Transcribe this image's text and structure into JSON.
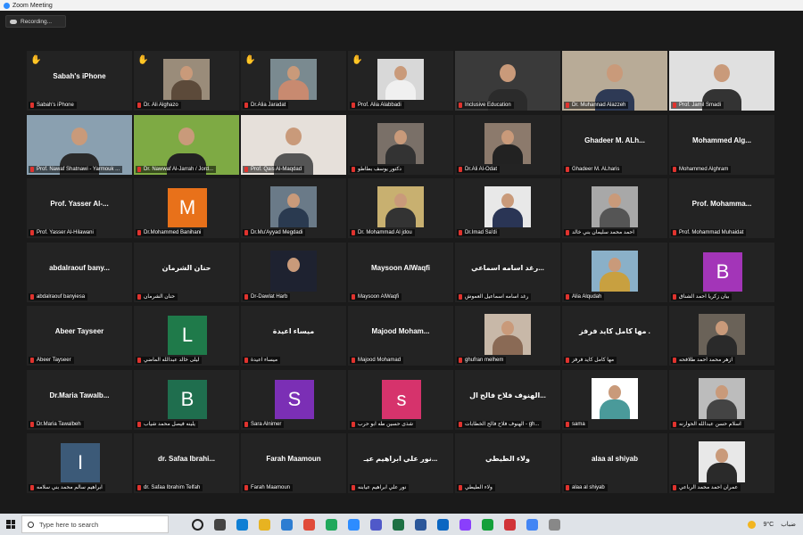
{
  "window": {
    "title": "Zoom Meeting"
  },
  "recording": {
    "label": "Recording..."
  },
  "accent": "#a6e22e",
  "tiles": [
    {
      "label": "Sabah's iPhone",
      "center": "Sabah's iPhone",
      "hand": true,
      "kind": "name"
    },
    {
      "label": "Dr. Ali Alghazo",
      "hand": true,
      "kind": "photo",
      "c1": "#9a8c7a",
      "c2": "#5c4a3a"
    },
    {
      "label": "Dr.Alia Jaradat",
      "hand": true,
      "kind": "photo",
      "c1": "#7a8a90",
      "c2": "#c88a70"
    },
    {
      "label": "Prof. Alia Alabbadi",
      "hand": true,
      "kind": "photo",
      "c1": "#d8d8d8",
      "c2": "#f0f0f0"
    },
    {
      "label": "Inclusive Education",
      "kind": "wide",
      "c1": "#3a3a3a",
      "c2": "#2b2b2b"
    },
    {
      "label": "Dr. Muhannad Alazzeh",
      "kind": "wide",
      "active": true,
      "c1": "#b8ab97",
      "c2": "#2e3a55"
    },
    {
      "label": "Prof. Jamil Smadi",
      "kind": "wide",
      "c1": "#e0e0e0",
      "c2": "#333"
    },
    {
      "label": "Prof. Nawaf Shatnawi - Yarmouk ...",
      "kind": "wide",
      "c1": "#8aa0b0",
      "c2": "#2a2a2a"
    },
    {
      "label": "Dr. Nawwaf Al-Jarrah / Jord...",
      "kind": "wide",
      "c1": "#7eaa44",
      "c2": "#222"
    },
    {
      "label": "Prof. Qais Al-Maqdad",
      "kind": "wide",
      "c1": "#e6e0da",
      "c2": "#555"
    },
    {
      "label": "دكتور يوسف بطاطو",
      "kind": "photo",
      "c1": "#7a7068",
      "c2": "#333"
    },
    {
      "label": "Dr.Ali Al-Odat",
      "kind": "photo",
      "c1": "#8c7a6c",
      "c2": "#222"
    },
    {
      "label": "Ghadeer M. ALharis",
      "center": "Ghadeer M. ALh...",
      "kind": "name"
    },
    {
      "label": "Mohammed Alghram",
      "center": "Mohammed Alg...",
      "kind": "name"
    },
    {
      "label": "Prof. Yasser Al-Hilawani",
      "center": "Prof. Yasser Al-...",
      "kind": "name"
    },
    {
      "label": "Dr.Mohammed Banihani",
      "kind": "avatar",
      "letter": "M",
      "color": "#e8711a"
    },
    {
      "label": "Dr.Mu'Ayyad Megdadi",
      "kind": "photo",
      "c1": "#6a7a88",
      "c2": "#2a3a50"
    },
    {
      "label": "Dr. Mohammad Al jdou",
      "kind": "photo",
      "c1": "#c8b070",
      "c2": "#333"
    },
    {
      "label": "Dr.Imad Sa'di",
      "kind": "photo",
      "c1": "#e8e8e8",
      "c2": "#2a3555"
    },
    {
      "label": "احمد محمد سليمان بني خالد",
      "kind": "photo",
      "c1": "#a8a8a8",
      "c2": "#555"
    },
    {
      "label": "Prof. Mohammad Muhaidat",
      "center": "Prof. Mohamma...",
      "kind": "name"
    },
    {
      "label": "abdalraouf banyiesa",
      "center": "abdalraouf bany...",
      "kind": "name"
    },
    {
      "label": "حنان الشرمان",
      "center": "حنان الشرمان",
      "kind": "name"
    },
    {
      "label": "Dr-Dawlat Harb",
      "kind": "photo",
      "c1": "#1e2230",
      "c2": "#1e2230"
    },
    {
      "label": "Maysoon AlWaqfi",
      "center": "Maysoon AlWaqfi",
      "kind": "name"
    },
    {
      "label": "رغد اسامه اسماعيل العموش",
      "center": "رغد اسامه اسماعي...",
      "kind": "name"
    },
    {
      "label": "Alia Alqudah",
      "kind": "photo",
      "c1": "#8ab0c8",
      "c2": "#c8a040"
    },
    {
      "label": "بيان زكريا احمد الشناق",
      "kind": "avatar",
      "letter": "B",
      "color": "#a335b8"
    },
    {
      "label": "Abeer Tayseer",
      "center": "Abeer Tayseer",
      "kind": "name"
    },
    {
      "label": "ليلى خالد عبدالله الماضي",
      "kind": "avatar",
      "letter": "L",
      "color": "#1f7a4a"
    },
    {
      "label": "ميساء اعيدة",
      "center": "ميساء اعيدة",
      "kind": "name"
    },
    {
      "label": "Majood Mohamad",
      "center": "Majood Moham...",
      "kind": "name"
    },
    {
      "label": "ghufran melhem",
      "kind": "photo",
      "c1": "#c8b8a8",
      "c2": "#8a6a55"
    },
    {
      "label": "مها كامل كايد فرفز",
      "center": "مها كامل كايد فرفز .",
      "kind": "name"
    },
    {
      "label": "ازهر محمد احمد طلافحه",
      "kind": "photo",
      "c1": "#6a6258",
      "c2": "#2a2a2a"
    },
    {
      "label": "Dr.Maria Tawalbeh",
      "center": "Dr.Maria Tawalb...",
      "kind": "name"
    },
    {
      "label": "يلينه فيصل محمد شياب",
      "kind": "avatar",
      "letter": "B",
      "color": "#1f6e4e"
    },
    {
      "label": "Sara Alnimer",
      "kind": "avatar",
      "letter": "S",
      "color": "#7b2fb5"
    },
    {
      "label": "شذى حسين طه ابو حرب",
      "kind": "avatar",
      "letter": "s",
      "color": "#d6336c"
    },
    {
      "label": "الهنوف فلاح فالح الخطابات - gh...",
      "center": "الهنوف فلاح فالح ال...",
      "kind": "name"
    },
    {
      "label": "sama",
      "kind": "photo",
      "c1": "#ffffff",
      "c2": "#4a9a9a"
    },
    {
      "label": "اسلام حسن عبدالله الحوارنه",
      "kind": "photo",
      "c1": "#bcbcbc",
      "c2": "#444"
    },
    {
      "label": "ابراهيم سالم محمد بني سلامه",
      "kind": "avatar",
      "letter": "I",
      "color": "#3c5a78"
    },
    {
      "label": "dr. Safaa Ibrahim Telfah",
      "center": "dr. Safaa Ibrahi...",
      "kind": "name"
    },
    {
      "label": "Farah Maamoun",
      "center": "Farah Maamoun",
      "kind": "name"
    },
    {
      "label": "نور علي ابراهيم عيابنه",
      "center": "نور علي ابراهيم عيـ...",
      "kind": "name"
    },
    {
      "label": "ولاء الطيطي",
      "center": "ولاء الطيطي",
      "kind": "name"
    },
    {
      "label": "alaa al shiyab",
      "center": "alaa al shiyab",
      "kind": "name"
    },
    {
      "label": "عمران احمد محمد الرباعي",
      "kind": "photo",
      "c1": "#e8e8e8",
      "c2": "#2a2a2a"
    }
  ],
  "taskbar": {
    "search_placeholder": "Type here to search",
    "weather": "9°C",
    "weather_text": "ضباب",
    "icon_colors": [
      "#222",
      "#444",
      "#0f7fd4",
      "#e7b321",
      "#2d7dd2",
      "#e04b3a",
      "#1fa85c",
      "#2d8cff",
      "#5059c9",
      "#1d7044",
      "#2b579a",
      "#0a66c2",
      "#8a3ffc",
      "#14a03a",
      "#d13438",
      "#4285f4",
      "#888"
    ]
  }
}
